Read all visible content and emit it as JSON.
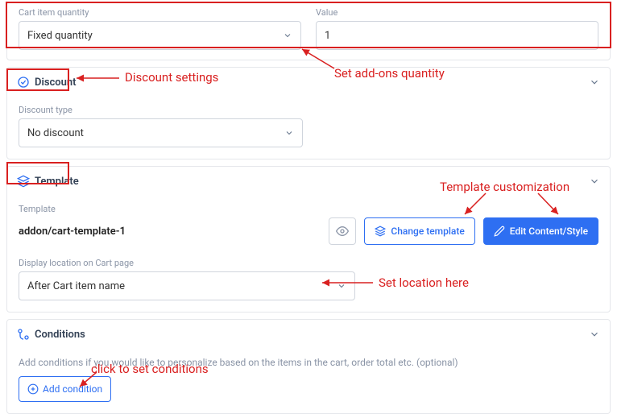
{
  "quantity_section": {
    "qty_label": "Cart item quantity",
    "qty_value": "Fixed quantity",
    "value_label": "Value",
    "value_value": "1"
  },
  "discount": {
    "header": "Discount",
    "type_label": "Discount type",
    "type_value": "No discount"
  },
  "template": {
    "header": "Template",
    "template_label": "Template",
    "template_name": "addon/cart-template-1",
    "change_btn": "Change template",
    "edit_btn": "Edit Content/Style",
    "location_label": "Display location on Cart page",
    "location_value": "After Cart item name"
  },
  "conditions": {
    "header": "Conditions",
    "help": "Add conditions if you would like to personalize based on the items in the cart, order total etc. (optional)",
    "add_btn": "Add condition"
  },
  "annotations": {
    "qty": "Set add-ons quantity",
    "discount": "Discount settings",
    "template": "Template customization",
    "location": "Set location here",
    "conditions": "click to set conditions"
  }
}
